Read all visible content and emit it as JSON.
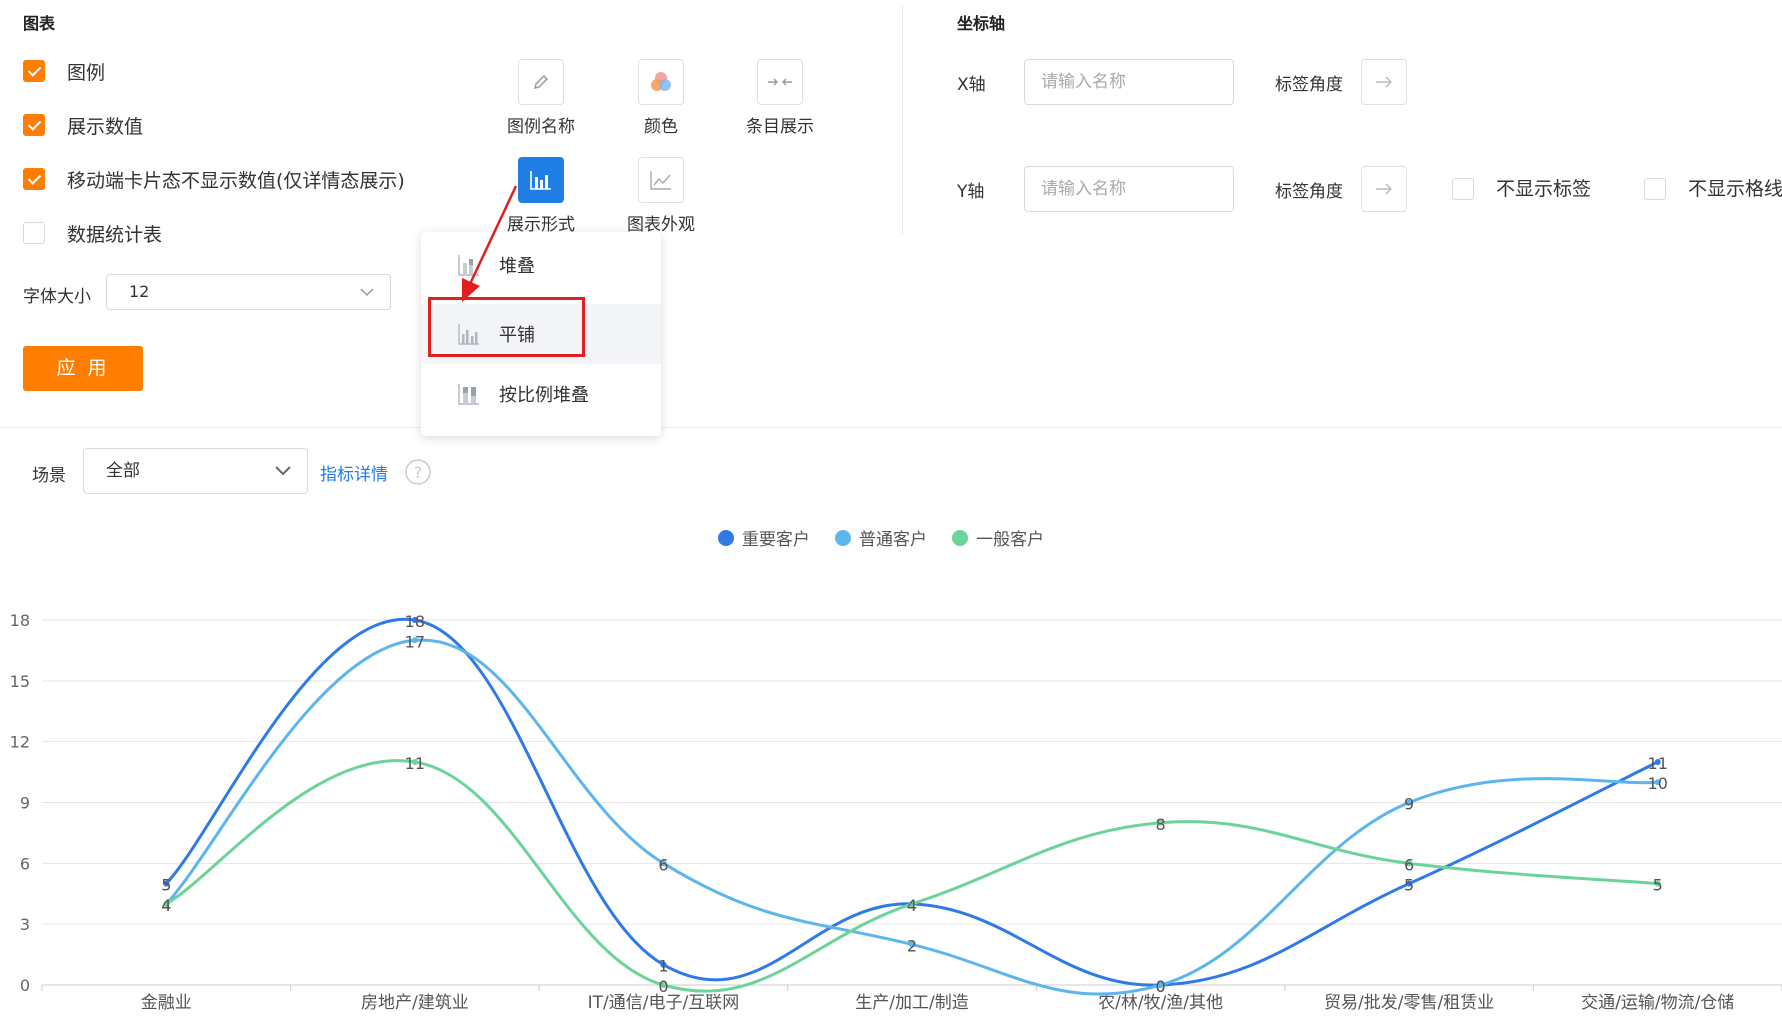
{
  "chart_panel": {
    "title": "图表",
    "checkboxes": [
      {
        "label": "图例",
        "checked": true
      },
      {
        "label": "展示数值",
        "checked": true
      },
      {
        "label": "移动端卡片态不显示数值(仅详情态展示)",
        "checked": true
      },
      {
        "label": "数据统计表",
        "checked": false
      }
    ],
    "font_size_label": "字体大小",
    "font_size_value": "12",
    "apply_label": "应 用",
    "tools": [
      {
        "label": "图例名称",
        "icon": "pencil-icon"
      },
      {
        "label": "颜色",
        "icon": "color-palette-icon"
      },
      {
        "label": "条目展示",
        "icon": "collapse-arrows-icon"
      },
      {
        "label": "展示形式",
        "icon": "bar-chart-icon"
      },
      {
        "label": "图表外观",
        "icon": "line-chart-icon"
      }
    ],
    "dropdown": [
      {
        "label": "堆叠",
        "icon": "stacked-bar-icon"
      },
      {
        "label": "平铺",
        "icon": "grouped-bar-icon"
      },
      {
        "label": "按比例堆叠",
        "icon": "percent-stacked-bar-icon"
      }
    ]
  },
  "axis_panel": {
    "title": "坐标轴",
    "x_label": "X轴",
    "y_label": "Y轴",
    "name_placeholder": "请输入名称",
    "angle_label": "标签角度",
    "hide_labels": "不显示标签",
    "hide_grid": "不显示格线"
  },
  "filter": {
    "scene_label": "场景",
    "scene_value": "全部",
    "detail_link": "指标详情"
  },
  "colors": {
    "accent": "#ff7d00",
    "primary": "#1f7de6",
    "highlight": "#e02020"
  },
  "chart_data": {
    "type": "line",
    "categories": [
      "金融业",
      "房地产/建筑业",
      "IT/通信/电子/互联网",
      "生产/加工/制造",
      "农/林/牧/渔/其他",
      "贸易/批发/零售/租赁业",
      "交通/运输/物流/仓储"
    ],
    "series": [
      {
        "name": "重要客户",
        "color": "#2f7ae6",
        "values": [
          5,
          18,
          1,
          4,
          0,
          5,
          11
        ]
      },
      {
        "name": "普通客户",
        "color": "#5db5ee",
        "values": [
          4,
          17,
          6,
          2,
          0,
          9,
          10
        ]
      },
      {
        "name": "一般客户",
        "color": "#6cd39a",
        "values": [
          4,
          11,
          0,
          4,
          8,
          6,
          5
        ]
      }
    ],
    "ylim": [
      0,
      18
    ],
    "yticks": [
      0,
      3,
      6,
      9,
      12,
      15,
      18
    ],
    "smooth": true,
    "grid": true,
    "legend_position": "top-center"
  }
}
